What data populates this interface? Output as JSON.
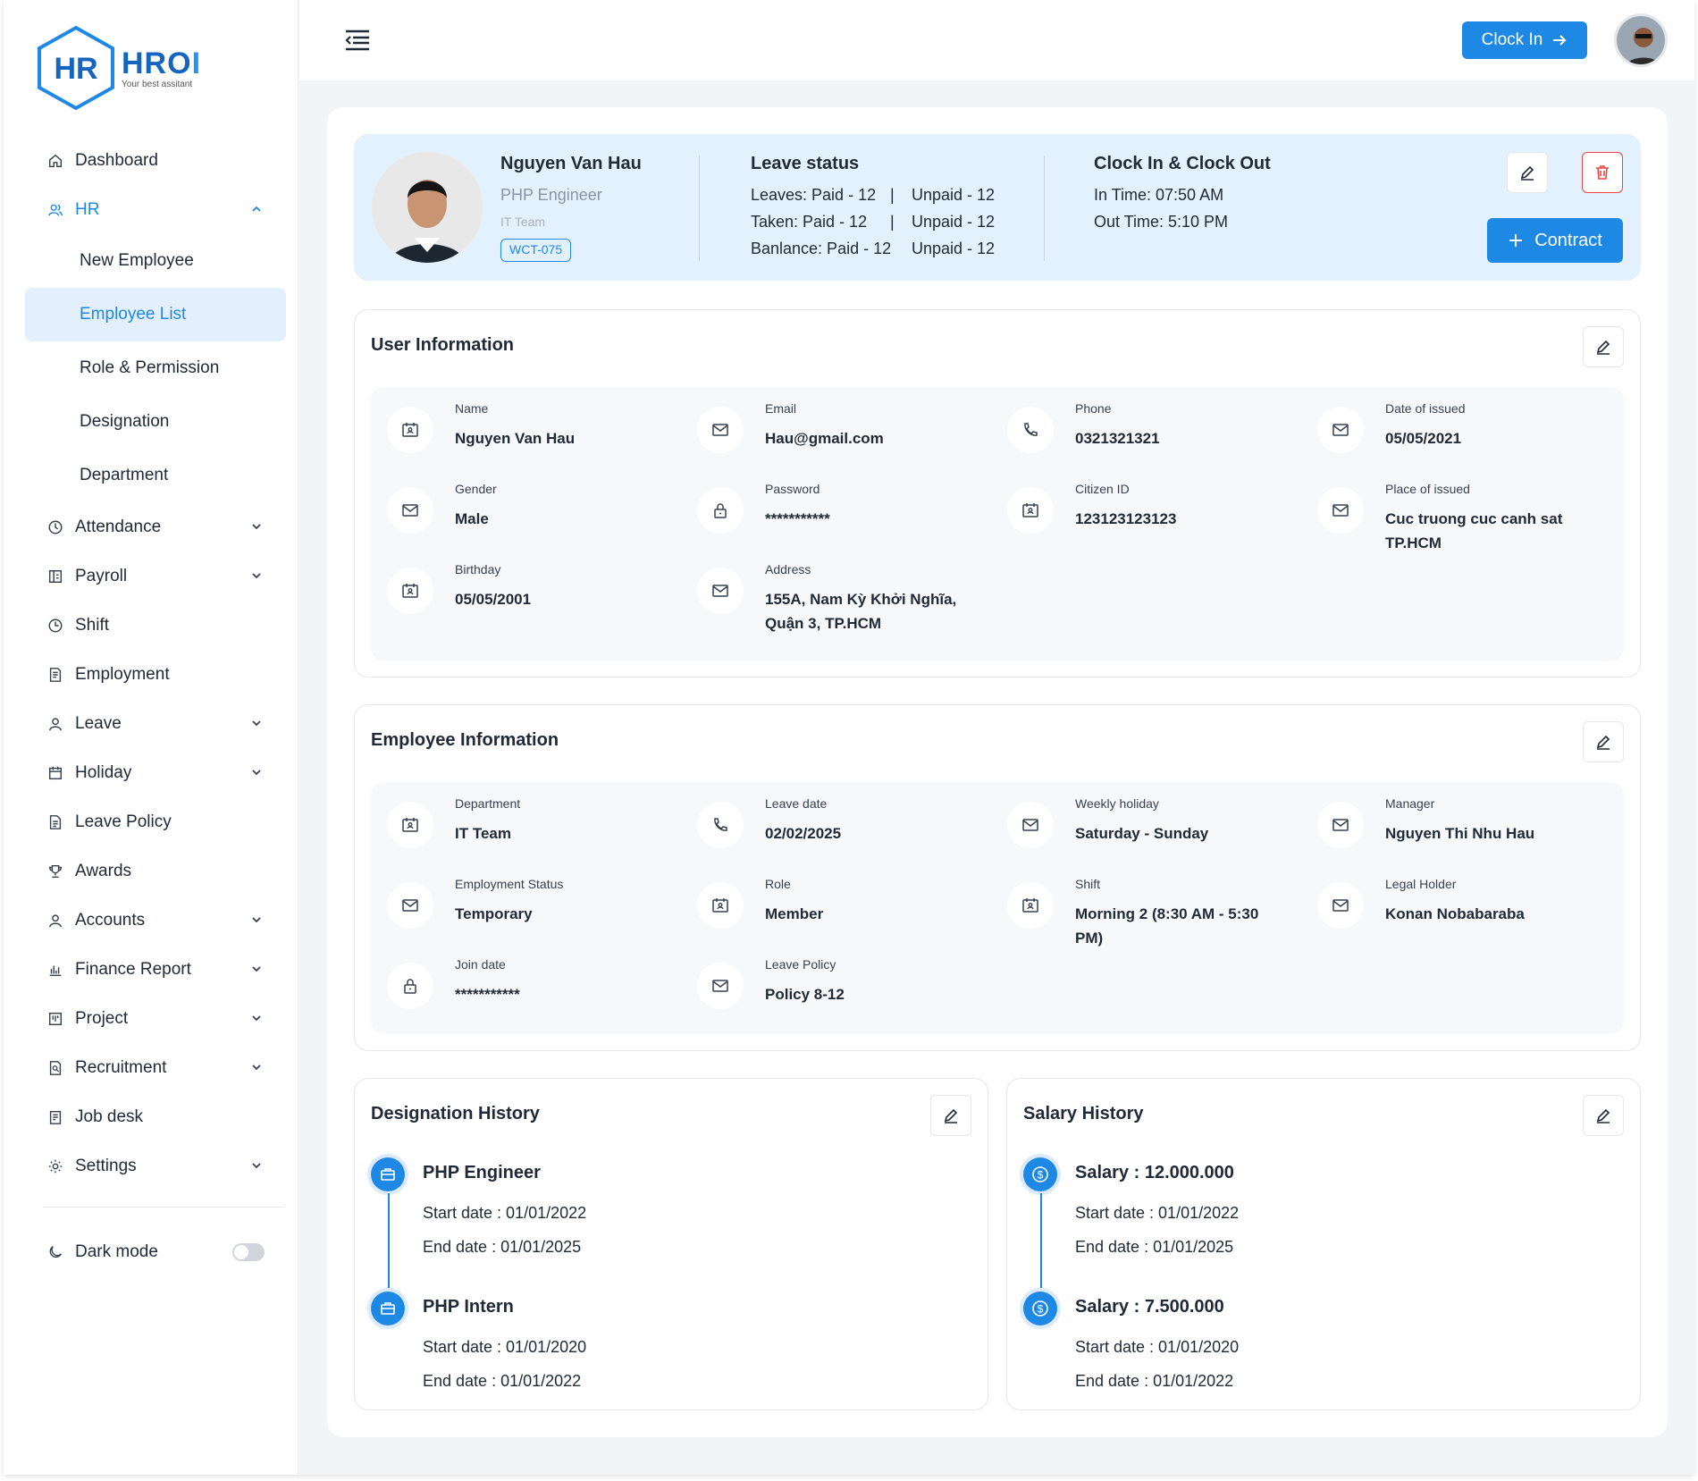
{
  "brand": {
    "name_dark": "HRO",
    "name_light": "I",
    "logo_text": "HR",
    "tagline": "Your best assitant"
  },
  "sidebar": {
    "items": [
      {
        "label": "Dashboard",
        "icon": "home-icon"
      },
      {
        "label": "HR",
        "icon": "users-icon",
        "expanded": true
      }
    ],
    "hr_sub": [
      "New  Employee",
      "Employee List",
      "Role & Permission",
      "Designation",
      "Department"
    ],
    "items2": [
      {
        "label": "Attendance",
        "icon": "clock-icon"
      },
      {
        "label": "Payroll",
        "icon": "payroll-icon"
      },
      {
        "label": "Shift",
        "icon": "shift-icon"
      },
      {
        "label": "Employment",
        "icon": "document-icon"
      },
      {
        "label": "Leave",
        "icon": "person-icon"
      },
      {
        "label": "Holiday",
        "icon": "calendar-icon"
      },
      {
        "label": "Leave Policy",
        "icon": "file-icon"
      },
      {
        "label": "Awards",
        "icon": "trophy-icon"
      },
      {
        "label": "Accounts",
        "icon": "person-icon"
      },
      {
        "label": "Finance Report",
        "icon": "bar-chart-icon"
      },
      {
        "label": "Project",
        "icon": "project-icon"
      },
      {
        "label": "Recruitment",
        "icon": "search-doc-icon"
      },
      {
        "label": "Job desk",
        "icon": "clipboard-icon"
      },
      {
        "label": "Settings",
        "icon": "gear-icon"
      }
    ],
    "dark_mode": "Dark mode"
  },
  "topbar": {
    "clock_in": "Clock In"
  },
  "profile": {
    "name": "Nguyen Van Hau",
    "role": "PHP Engineer",
    "team": "IT Team",
    "code": "WCT-075",
    "leave_title": "Leave status",
    "leave_rows": [
      {
        "a": "Leaves: Paid - 12",
        "b": "Unpaid - 12"
      },
      {
        "a": "Taken: Paid - 12",
        "b": "Unpaid - 12"
      },
      {
        "a": "Banlance: Paid - 12",
        "b": "Unpaid - 12"
      }
    ],
    "clock_title": "Clock In & Clock Out",
    "in_time": "In Time: 07:50 AM",
    "out_time": "Out Time: 5:10 PM",
    "contract": "Contract"
  },
  "user_info": {
    "title": "User Information",
    "fields": [
      {
        "label": "Name",
        "value": "Nguyen Van Hau",
        "icon": "id-card-icon"
      },
      {
        "label": "Email",
        "value": "Hau@gmail.com",
        "icon": "mail-icon"
      },
      {
        "label": "Phone",
        "value": "0321321321",
        "icon": "phone-icon"
      },
      {
        "label": "Date of issued",
        "value": "05/05/2021",
        "icon": "mail-icon"
      },
      {
        "label": "Gender",
        "value": "Male",
        "icon": "mail-icon"
      },
      {
        "label": "Password",
        "value": "***********",
        "icon": "lock-icon"
      },
      {
        "label": "Citizen ID",
        "value": "123123123123",
        "icon": "id-card-icon"
      },
      {
        "label": "Place of issued",
        "value": "Cuc truong cuc canh sat TP.HCM",
        "icon": "mail-icon"
      },
      {
        "label": "Birthday",
        "value": "05/05/2001",
        "icon": "id-card-icon"
      },
      {
        "label": "Address",
        "value": "155A, Nam Kỳ Khởi Nghĩa, Quận 3, TP.HCM",
        "icon": "mail-icon"
      }
    ]
  },
  "employee_info": {
    "title": "Employee Information",
    "fields": [
      {
        "label": "Department",
        "value": "IT Team",
        "icon": "id-card-icon"
      },
      {
        "label": "Leave date",
        "value": "02/02/2025",
        "icon": "phone-icon"
      },
      {
        "label": "Weekly holiday",
        "value": "Saturday - Sunday",
        "icon": "mail-icon"
      },
      {
        "label": "Manager",
        "value": "Nguyen Thi Nhu Hau",
        "icon": "mail-icon"
      },
      {
        "label": "Employment Status",
        "value": "Temporary",
        "icon": "mail-icon"
      },
      {
        "label": "Role",
        "value": "Member",
        "icon": "id-card-icon"
      },
      {
        "label": "Shift",
        "value": "Morning 2 (8:30 AM - 5:30 PM)",
        "icon": "id-card-icon"
      },
      {
        "label": "Legal Holder",
        "value": "Konan Nobabaraba",
        "icon": "mail-icon"
      },
      {
        "label": "Join date",
        "value": "***********",
        "icon": "lock-icon"
      },
      {
        "label": "Leave Policy",
        "value": "Policy 8-12",
        "icon": "mail-icon"
      }
    ]
  },
  "designation_history": {
    "title": "Designation History",
    "items": [
      {
        "title": "PHP Engineer",
        "start": "Start date : 01/01/2022",
        "end": "End date : 01/01/2025"
      },
      {
        "title": "PHP Intern",
        "start": "Start date : 01/01/2020",
        "end": "End date : 01/01/2022"
      }
    ]
  },
  "salary_history": {
    "title": "Salary History",
    "items": [
      {
        "title": "Salary : 12.000.000",
        "start": "Start date : 01/01/2022",
        "end": "End date : 01/01/2025"
      },
      {
        "title": "Salary : 7.500.000",
        "start": "Start date : 01/01/2020",
        "end": "End date : 01/01/2022"
      }
    ]
  },
  "colors": {
    "accent": "#1e88e5",
    "danger": "#ef4444",
    "profile_bg": "#e3f1fc"
  }
}
